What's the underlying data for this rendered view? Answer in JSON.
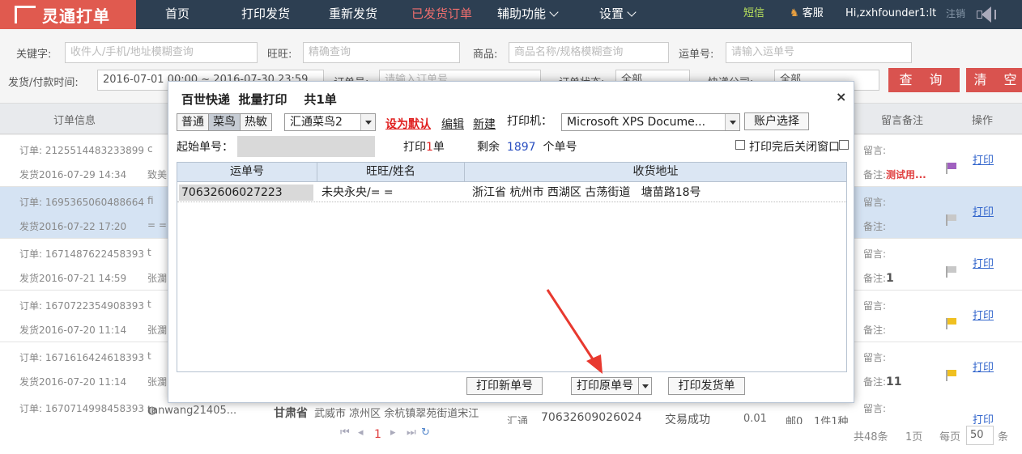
{
  "nav": {
    "logo": "灵通打单",
    "items": [
      {
        "label": "首页",
        "active": false
      },
      {
        "label": "打印发货",
        "active": false
      },
      {
        "label": "重新发货",
        "active": false
      },
      {
        "label": "已发货订单",
        "active": true
      },
      {
        "label": "辅助功能",
        "active": false
      },
      {
        "label": "设置",
        "active": false
      }
    ],
    "sms": "短信",
    "service": "客服",
    "user": "Hi,zxhfounder1:lt",
    "logout": "注销"
  },
  "filters": {
    "keyword_label": "关键字:",
    "keyword_placeholder": "收件人/手机/地址模糊查询",
    "wangwang_label": "旺旺:",
    "wangwang_placeholder": "精确查询",
    "goods_label": "商品:",
    "goods_placeholder": "商品名称/规格模糊查询",
    "waybill_label": "运单号:",
    "waybill_placeholder": "请输入运单号",
    "time_label": "发货/付款时间:",
    "time_value": "2016-07-01 00:00 ~ 2016-07-30 23:59",
    "order_label": "订单号:",
    "order_placeholder": "请输入订单号",
    "status_label": "订单状态:",
    "status_value": "全部",
    "express_label": "快递公司:",
    "express_value": "全部",
    "query_button": "查 询",
    "clear_button": "清 空"
  },
  "table": {
    "headers": {
      "order_info": "订单信息",
      "remark": "留言备注",
      "action": "操作"
    },
    "rows": [
      {
        "order": "订单: 2125514483233899",
        "date": "发货2016-07-29 14:34",
        "extra": "c",
        "extra2": "致美",
        "note": "留言:",
        "memo_label": "备注:",
        "memo": "测试用...",
        "flag": "#a060c0",
        "action": "打印"
      },
      {
        "order": "订单: 1695365060488664",
        "date": "发货2016-07-22 17:20",
        "extra": "fi",
        "extra2": "= =",
        "note": "留言:",
        "memo_label": "备注:",
        "memo": "",
        "flag": "#c8c8c8",
        "action": "打印"
      },
      {
        "order": "订单: 1671487622458393",
        "date": "发货2016-07-21 14:59",
        "extra": "t",
        "extra2": "张瀾",
        "note": "留言:",
        "memo_label": "备注:",
        "memo": "1",
        "flag": "#c8c8c8",
        "action": "打印"
      },
      {
        "order": "订单: 1670722354908393",
        "date": "发货2016-07-20 11:14",
        "extra": "t",
        "extra2": "张瀾",
        "note": "留言:",
        "memo_label": "备注:",
        "memo": "",
        "flag": "#f0c020",
        "action": "打印"
      },
      {
        "order": "订单: 1671616424618393",
        "date": "发货2016-07-20 11:14",
        "extra": "t",
        "extra2": "张瀾",
        "note": "留言:",
        "memo_label": "备注:",
        "memo": "11",
        "flag": "#f0c020",
        "action": "打印"
      }
    ],
    "last_row": {
      "order": "订单: 1670714998458393",
      "wangwang": "tanwang21405...",
      "province": "甘肃省",
      "address": "武威市 凉州区 余杭镇翠苑街道宋江",
      "express": "汇通",
      "waybill": "70632609026024",
      "status": "交易成功",
      "amount": "0.01",
      "post": "邮0",
      "count": "1件1种",
      "note": "留言:",
      "action": "打印"
    }
  },
  "footer": {
    "current_page": "1",
    "total": "共48条",
    "pages": "1页",
    "per_page_label": "每页",
    "per_page": "50",
    "unit": "条"
  },
  "modal": {
    "title": "百世快递  批量打印    共1单",
    "close": "×",
    "modes": [
      "普通",
      "菜鸟",
      "热敏"
    ],
    "active_mode": "菜鸟",
    "template": "汇通菜鸟2",
    "set_default": "设为默认",
    "edit": "编辑",
    "new": "新建",
    "printer_label": "打印机：",
    "printer": "Microsoft XPS Docume...",
    "account_button": "账户选择",
    "start_label": "起始单号：",
    "print_count_prefix": "打印",
    "print_count": "1",
    "print_count_suffix": "单",
    "remain_prefix": "剩余",
    "remain": "1897",
    "remain_suffix": "个单号",
    "close_after_print": "打印完后关闭窗口",
    "grid_headers": [
      "运单号",
      "旺旺/姓名",
      "收货地址"
    ],
    "grid_rows": [
      {
        "waybill": "70632606027223",
        "name": "未央永央/= =",
        "address": "浙江省 杭州市 西湖区 古荡街道   塘苗路18号"
      }
    ],
    "btn_new_number": "打印新单号",
    "btn_original": "打印原单号",
    "btn_delivery": "打印发货单"
  },
  "colors": {
    "nav_bg": "#2d3f52",
    "brand": "#e05a4f",
    "arrow": "#e8392f",
    "link": "#3366cc"
  }
}
